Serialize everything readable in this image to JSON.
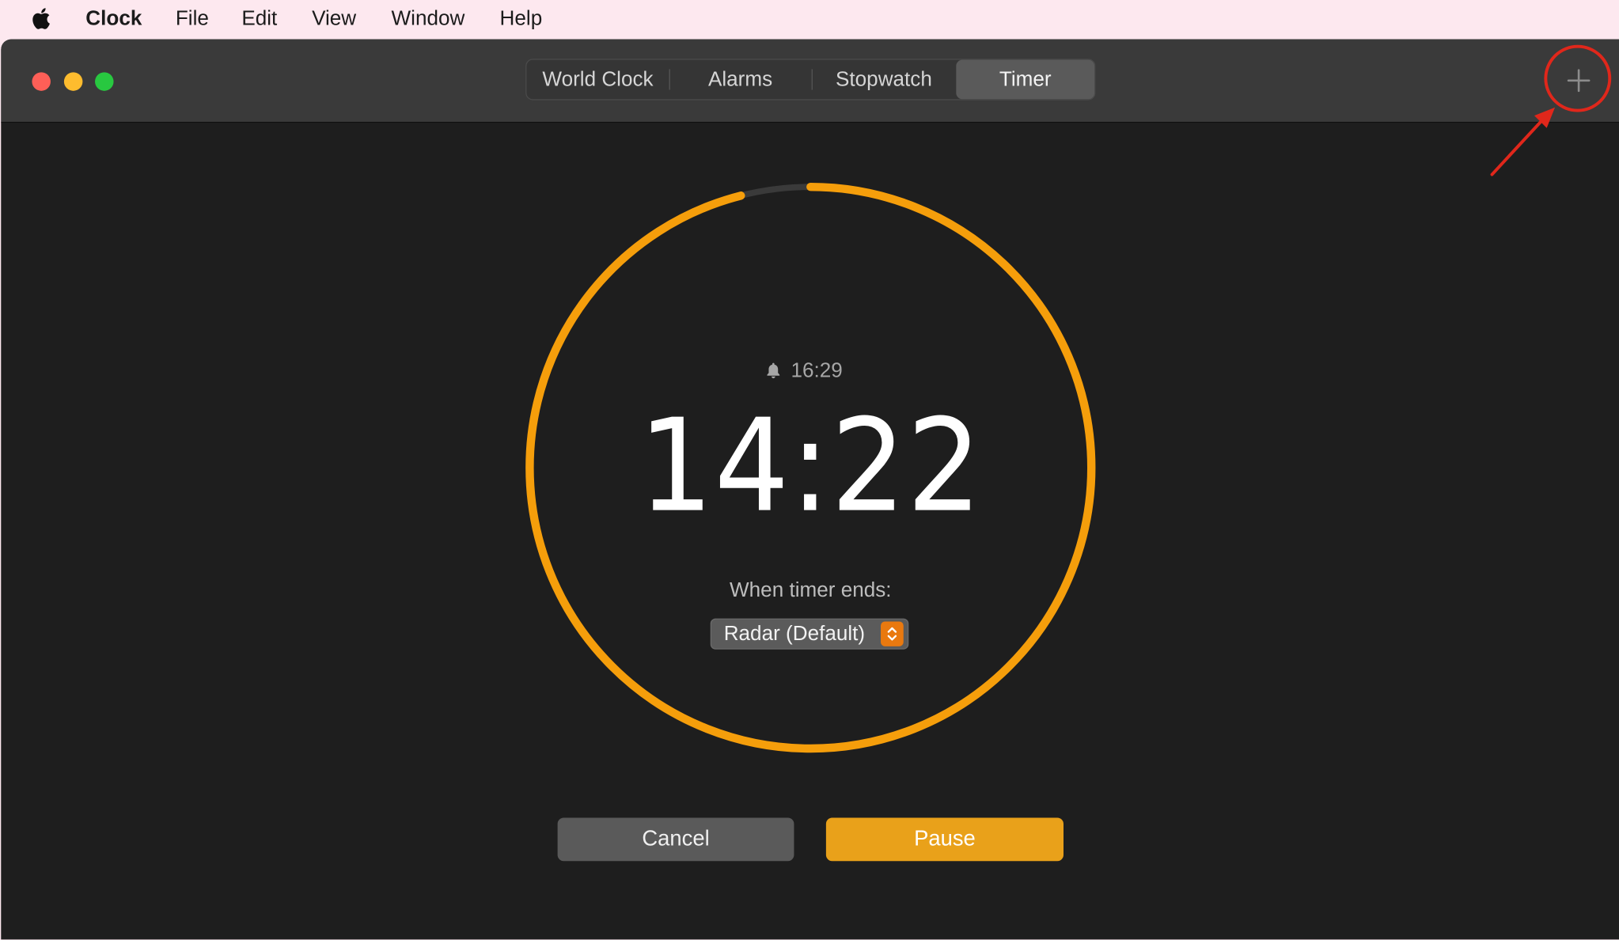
{
  "menubar": {
    "app_name": "Clock",
    "items": [
      "File",
      "Edit",
      "View",
      "Window",
      "Help"
    ]
  },
  "toolbar": {
    "tabs": [
      {
        "label": "World Clock",
        "selected": false
      },
      {
        "label": "Alarms",
        "selected": false
      },
      {
        "label": "Stopwatch",
        "selected": false
      },
      {
        "label": "Timer",
        "selected": true
      }
    ],
    "add_icon": "plus-icon"
  },
  "timer": {
    "alarm_time": "16:29",
    "remaining": "14:22",
    "progress_remaining_fraction": 0.96,
    "ends_label": "When timer ends:",
    "sound": "Radar (Default)",
    "cancel_label": "Cancel",
    "pause_label": "Pause"
  },
  "colors": {
    "accent": "#f59e0b",
    "ring_track": "#3a3a3a",
    "pause_button": "#e9a11a",
    "annotation": "#e0271b"
  }
}
